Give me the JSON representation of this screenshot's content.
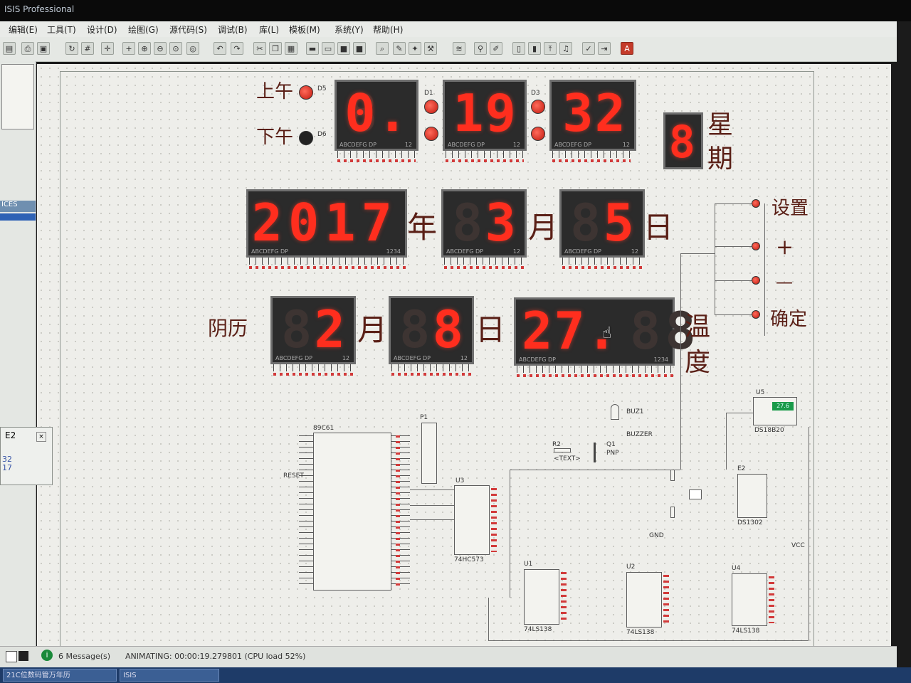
{
  "window": {
    "title": "ISIS Professional"
  },
  "menu": [
    "编辑(E)",
    "工具(T)",
    "设计(D)",
    "绘图(G)",
    "源代码(S)",
    "调试(B)",
    "库(L)",
    "模板(M)",
    "系统(Y)",
    "帮助(H)"
  ],
  "left_panel": {
    "devices_label": "ICES",
    "float_title": "E2",
    "float_values": [
      "32",
      "17"
    ]
  },
  "time": {
    "am_label": "上午",
    "pm_label": "下午",
    "hour": "0.",
    "minute": "19",
    "second": "32",
    "led_d5": "D5",
    "led_d6": "D6",
    "led_d1": "D1",
    "led_d3": "D3"
  },
  "week": {
    "value": "8",
    "label_1": "星",
    "label_2": "期"
  },
  "date": {
    "year": "2017",
    "year_unit": "年",
    "month": "3",
    "month_unit": "月",
    "day": "5",
    "day_unit": "日"
  },
  "lunar": {
    "label": "阴历",
    "month": "2",
    "month_unit": "月",
    "day": "8",
    "day_unit": "日"
  },
  "temperature": {
    "value": "27.",
    "label_1": "温",
    "label_2": "度"
  },
  "buttons": {
    "set": "设置",
    "plus": "+",
    "minus": "—",
    "confirm": "确定"
  },
  "segment_labels": {
    "abcdefg": "ABCDEFG DP",
    "p12": "12",
    "p1234": "1234"
  },
  "components": {
    "mcu": "89C61",
    "p1": "P1",
    "u3": "U3",
    "u1": "U1",
    "u2": "U2",
    "u4": "U4",
    "u5": "U5",
    "e2": "E2",
    "buz": "BUZ1",
    "q1": "Q1",
    "r2": "R2",
    "u5_part": "DS18B20",
    "u5_display": "27.6",
    "buz_part": "BUZZER",
    "q1_type": "PNP",
    "ls_part": "74LS138",
    "u3_part": "74HC573",
    "e2_part": "DS1302",
    "text_tag": "<TEXT>",
    "vcc": "VCC",
    "gnd": "GND",
    "reset": "RESET"
  },
  "status": {
    "messages": "6 Message(s)",
    "animating": "ANIMATING: 00:00:19.279801 (CPU load 52%)"
  },
  "taskbar": [
    "21C位数码管万年历",
    "ISIS"
  ],
  "colors": {
    "segment_on": "#ff2e1e",
    "canvas": "#eeeeea",
    "label": "#5a1f16"
  }
}
